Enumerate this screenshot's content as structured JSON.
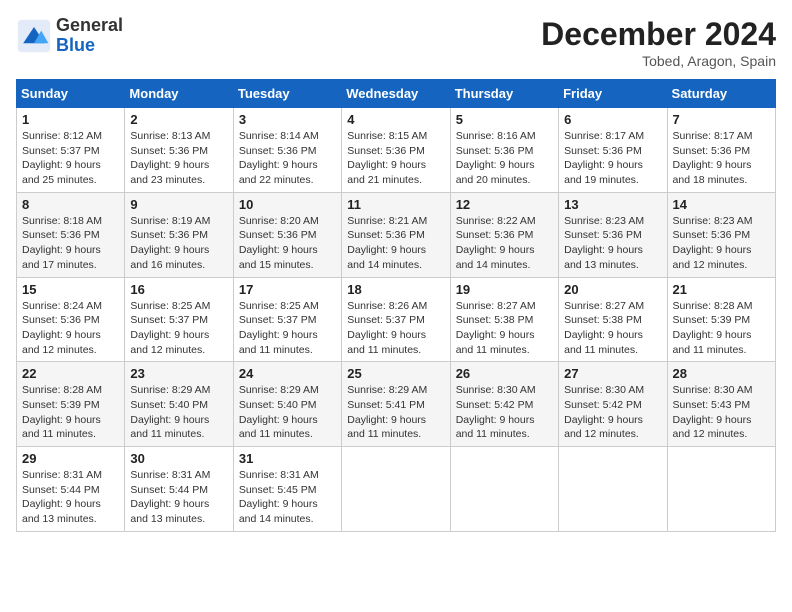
{
  "header": {
    "logo_general": "General",
    "logo_blue": "Blue",
    "main_title": "December 2024",
    "subtitle": "Tobed, Aragon, Spain"
  },
  "columns": [
    "Sunday",
    "Monday",
    "Tuesday",
    "Wednesday",
    "Thursday",
    "Friday",
    "Saturday"
  ],
  "weeks": [
    [
      {
        "day": "1",
        "sunrise": "8:12 AM",
        "sunset": "5:37 PM",
        "daylight": "9 hours and 25 minutes."
      },
      {
        "day": "2",
        "sunrise": "8:13 AM",
        "sunset": "5:36 PM",
        "daylight": "9 hours and 23 minutes."
      },
      {
        "day": "3",
        "sunrise": "8:14 AM",
        "sunset": "5:36 PM",
        "daylight": "9 hours and 22 minutes."
      },
      {
        "day": "4",
        "sunrise": "8:15 AM",
        "sunset": "5:36 PM",
        "daylight": "9 hours and 21 minutes."
      },
      {
        "day": "5",
        "sunrise": "8:16 AM",
        "sunset": "5:36 PM",
        "daylight": "9 hours and 20 minutes."
      },
      {
        "day": "6",
        "sunrise": "8:17 AM",
        "sunset": "5:36 PM",
        "daylight": "9 hours and 19 minutes."
      },
      {
        "day": "7",
        "sunrise": "8:17 AM",
        "sunset": "5:36 PM",
        "daylight": "9 hours and 18 minutes."
      }
    ],
    [
      {
        "day": "8",
        "sunrise": "8:18 AM",
        "sunset": "5:36 PM",
        "daylight": "9 hours and 17 minutes."
      },
      {
        "day": "9",
        "sunrise": "8:19 AM",
        "sunset": "5:36 PM",
        "daylight": "9 hours and 16 minutes."
      },
      {
        "day": "10",
        "sunrise": "8:20 AM",
        "sunset": "5:36 PM",
        "daylight": "9 hours and 15 minutes."
      },
      {
        "day": "11",
        "sunrise": "8:21 AM",
        "sunset": "5:36 PM",
        "daylight": "9 hours and 14 minutes."
      },
      {
        "day": "12",
        "sunrise": "8:22 AM",
        "sunset": "5:36 PM",
        "daylight": "9 hours and 14 minutes."
      },
      {
        "day": "13",
        "sunrise": "8:23 AM",
        "sunset": "5:36 PM",
        "daylight": "9 hours and 13 minutes."
      },
      {
        "day": "14",
        "sunrise": "8:23 AM",
        "sunset": "5:36 PM",
        "daylight": "9 hours and 12 minutes."
      }
    ],
    [
      {
        "day": "15",
        "sunrise": "8:24 AM",
        "sunset": "5:36 PM",
        "daylight": "9 hours and 12 minutes."
      },
      {
        "day": "16",
        "sunrise": "8:25 AM",
        "sunset": "5:37 PM",
        "daylight": "9 hours and 12 minutes."
      },
      {
        "day": "17",
        "sunrise": "8:25 AM",
        "sunset": "5:37 PM",
        "daylight": "9 hours and 11 minutes."
      },
      {
        "day": "18",
        "sunrise": "8:26 AM",
        "sunset": "5:37 PM",
        "daylight": "9 hours and 11 minutes."
      },
      {
        "day": "19",
        "sunrise": "8:27 AM",
        "sunset": "5:38 PM",
        "daylight": "9 hours and 11 minutes."
      },
      {
        "day": "20",
        "sunrise": "8:27 AM",
        "sunset": "5:38 PM",
        "daylight": "9 hours and 11 minutes."
      },
      {
        "day": "21",
        "sunrise": "8:28 AM",
        "sunset": "5:39 PM",
        "daylight": "9 hours and 11 minutes."
      }
    ],
    [
      {
        "day": "22",
        "sunrise": "8:28 AM",
        "sunset": "5:39 PM",
        "daylight": "9 hours and 11 minutes."
      },
      {
        "day": "23",
        "sunrise": "8:29 AM",
        "sunset": "5:40 PM",
        "daylight": "9 hours and 11 minutes."
      },
      {
        "day": "24",
        "sunrise": "8:29 AM",
        "sunset": "5:40 PM",
        "daylight": "9 hours and 11 minutes."
      },
      {
        "day": "25",
        "sunrise": "8:29 AM",
        "sunset": "5:41 PM",
        "daylight": "9 hours and 11 minutes."
      },
      {
        "day": "26",
        "sunrise": "8:30 AM",
        "sunset": "5:42 PM",
        "daylight": "9 hours and 11 minutes."
      },
      {
        "day": "27",
        "sunrise": "8:30 AM",
        "sunset": "5:42 PM",
        "daylight": "9 hours and 12 minutes."
      },
      {
        "day": "28",
        "sunrise": "8:30 AM",
        "sunset": "5:43 PM",
        "daylight": "9 hours and 12 minutes."
      }
    ],
    [
      {
        "day": "29",
        "sunrise": "8:31 AM",
        "sunset": "5:44 PM",
        "daylight": "9 hours and 13 minutes."
      },
      {
        "day": "30",
        "sunrise": "8:31 AM",
        "sunset": "5:44 PM",
        "daylight": "9 hours and 13 minutes."
      },
      {
        "day": "31",
        "sunrise": "8:31 AM",
        "sunset": "5:45 PM",
        "daylight": "9 hours and 14 minutes."
      },
      null,
      null,
      null,
      null
    ]
  ],
  "labels": {
    "sunrise": "Sunrise:",
    "sunset": "Sunset:",
    "daylight": "Daylight:"
  }
}
